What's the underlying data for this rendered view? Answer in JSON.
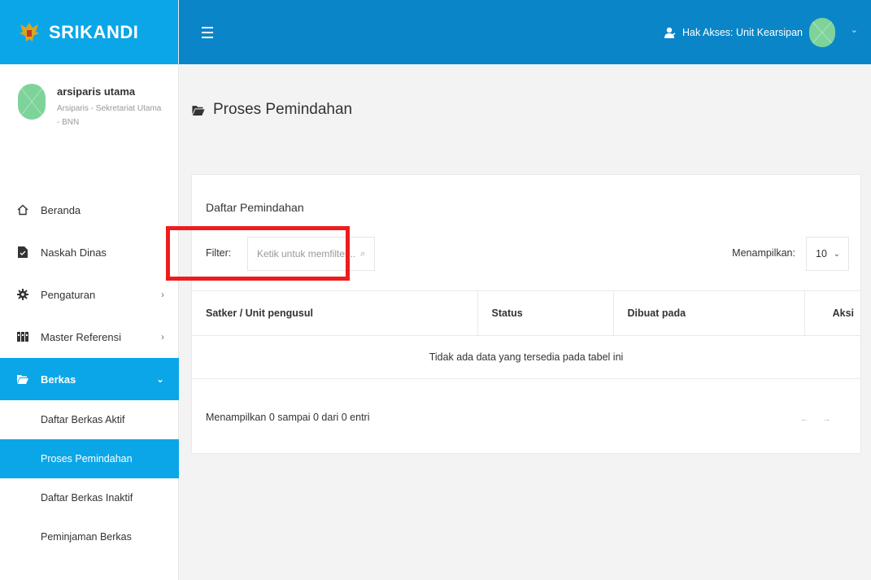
{
  "brand": {
    "name": "SRIKANDI"
  },
  "profile": {
    "name": "arsiparis utama",
    "role": "Arsiparis - Sekretariat Utama - BNN"
  },
  "sidebar": {
    "items": [
      {
        "label": "Beranda",
        "icon": "home-icon"
      },
      {
        "label": "Naskah Dinas",
        "icon": "document-icon"
      },
      {
        "label": "Pengaturan",
        "icon": "gear-icon"
      },
      {
        "label": "Master Referensi",
        "icon": "binders-icon"
      },
      {
        "label": "Berkas",
        "icon": "folder-open-icon"
      }
    ],
    "subitems": [
      {
        "label": "Daftar Berkas Aktif"
      },
      {
        "label": "Proses Pemindahan"
      },
      {
        "label": "Daftar Berkas Inaktif"
      },
      {
        "label": "Peminjaman Berkas"
      }
    ]
  },
  "topbar": {
    "access_label": "Hak Akses: Unit Kearsipan"
  },
  "page": {
    "title": "Proses Pemindahan"
  },
  "card": {
    "title": "Daftar Pemindahan",
    "filter_label": "Filter:",
    "filter_placeholder": "Ketik untuk memfilter...",
    "show_label": "Menampilkan:",
    "show_value": "10"
  },
  "table": {
    "headers": [
      "Satker / Unit pengusul",
      "Status",
      "Dibuat pada",
      "Aksi"
    ],
    "empty_message": "Tidak ada data yang tersedia pada tabel ini"
  },
  "footer": {
    "info": "Menampilkan 0 sampai 0 dari 0 entri"
  },
  "colors": {
    "brand": "#0aa6e8",
    "topbar": "#0a86c8",
    "highlight": "#ee1c1c",
    "avatar": "#7ed39a"
  }
}
